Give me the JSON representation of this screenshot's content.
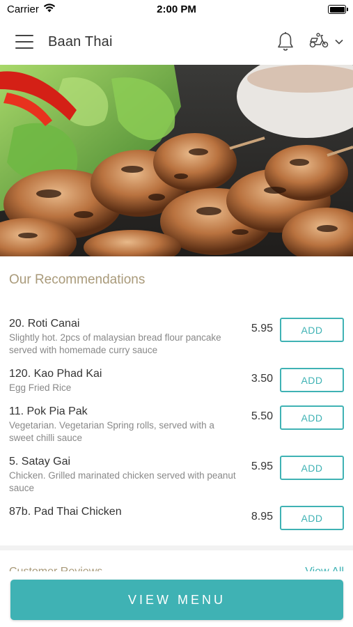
{
  "status_bar": {
    "carrier": "Carrier",
    "time": "2:00 PM",
    "wifi_icon": "wifi-icon",
    "battery_icon": "battery-icon"
  },
  "header": {
    "menu_icon": "hamburger-menu-icon",
    "title": "Baan Thai",
    "bell_icon": "bell-icon",
    "delivery_icon": "scooter-icon",
    "dropdown_icon": "chevron-down-icon"
  },
  "hero": {
    "description": "chicken satay skewers with lettuce and dipping sauce"
  },
  "recommendations": {
    "title": "Our Recommendations",
    "add_label": "ADD",
    "items": [
      {
        "name": "20. Roti Canai",
        "description": "Slightly hot. 2pcs of malaysian bread flour pancake served with homemade curry sauce",
        "price": "5.95"
      },
      {
        "name": "120. Kao Phad Kai",
        "description": "Egg Fried Rice",
        "price": "3.50"
      },
      {
        "name": "11. Pok Pia Pak",
        "description": "Vegetarian. Vegetarian Spring rolls, served with a sweet chilli sauce",
        "price": "5.50"
      },
      {
        "name": "5. Satay Gai",
        "description": "Chicken. Grilled marinated chicken served with peanut sauce",
        "price": "5.95"
      },
      {
        "name": "87b. Pad Thai Chicken",
        "description": "",
        "price": "8.95"
      }
    ]
  },
  "reviews": {
    "title": "Customer Reviews",
    "view_all": "View All"
  },
  "footer": {
    "view_menu_label": "VIEW MENU"
  },
  "colors": {
    "accent": "#3fb2b4",
    "section_title": "#a99a7a"
  }
}
